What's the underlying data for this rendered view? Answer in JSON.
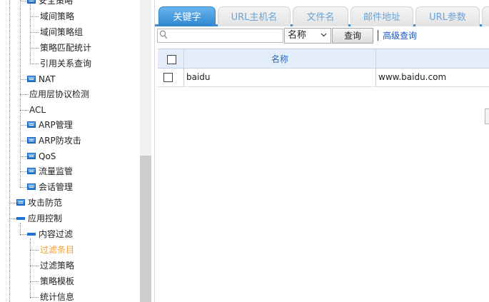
{
  "tree": {
    "items": [
      {
        "label": "安全策略",
        "level": 1,
        "type": "folder"
      },
      {
        "label": "域间策略",
        "level": 2,
        "type": "leaf"
      },
      {
        "label": "域间策略组",
        "level": 2,
        "type": "leaf"
      },
      {
        "label": "策略匹配统计",
        "level": 2,
        "type": "leaf"
      },
      {
        "label": "引用关系查询",
        "level": 2,
        "type": "leaf"
      },
      {
        "label": "NAT",
        "level": 1,
        "type": "folder"
      },
      {
        "label": "应用层协议检测",
        "level": 1,
        "type": "leaf"
      },
      {
        "label": "ACL",
        "level": 1,
        "type": "leaf"
      },
      {
        "label": "ARP管理",
        "level": 1,
        "type": "folder"
      },
      {
        "label": "ARP防攻击",
        "level": 1,
        "type": "folder"
      },
      {
        "label": "QoS",
        "level": 1,
        "type": "folder"
      },
      {
        "label": "流量监管",
        "level": 1,
        "type": "folder"
      },
      {
        "label": "会话管理",
        "level": 1,
        "type": "folder"
      },
      {
        "label": "攻击防范",
        "level": 0,
        "type": "folder"
      },
      {
        "label": "应用控制",
        "level": 0,
        "type": "open-folder"
      },
      {
        "label": "内容过滤",
        "level": 1,
        "type": "open-folder"
      },
      {
        "label": "过滤条目",
        "level": 2,
        "type": "leaf",
        "active": true
      },
      {
        "label": "过滤策略",
        "level": 2,
        "type": "leaf"
      },
      {
        "label": "策略模板",
        "level": 2,
        "type": "leaf"
      },
      {
        "label": "统计信息",
        "level": 2,
        "type": "leaf"
      }
    ],
    "active_color": "#f0a030"
  },
  "tabs": [
    {
      "label": "关键字",
      "active": true
    },
    {
      "label": "URL主机名",
      "active": false
    },
    {
      "label": "文件名",
      "active": false
    },
    {
      "label": "邮件地址",
      "active": false
    },
    {
      "label": "URL参数",
      "active": false
    }
  ],
  "toolbar": {
    "search_value": "",
    "search_placeholder": "",
    "field_select": "名称",
    "query_button": "查询",
    "advanced_link": "高级查询"
  },
  "grid": {
    "columns": [
      "",
      "名称",
      ""
    ],
    "rows": [
      {
        "name": "baidu",
        "value": "www.baidu.com"
      }
    ]
  },
  "colors": {
    "tab_active": "#2f86cf",
    "tab_inactive_text": "#6aa4d8",
    "link": "#1a56c4",
    "header_bg": "#e4eefa"
  }
}
